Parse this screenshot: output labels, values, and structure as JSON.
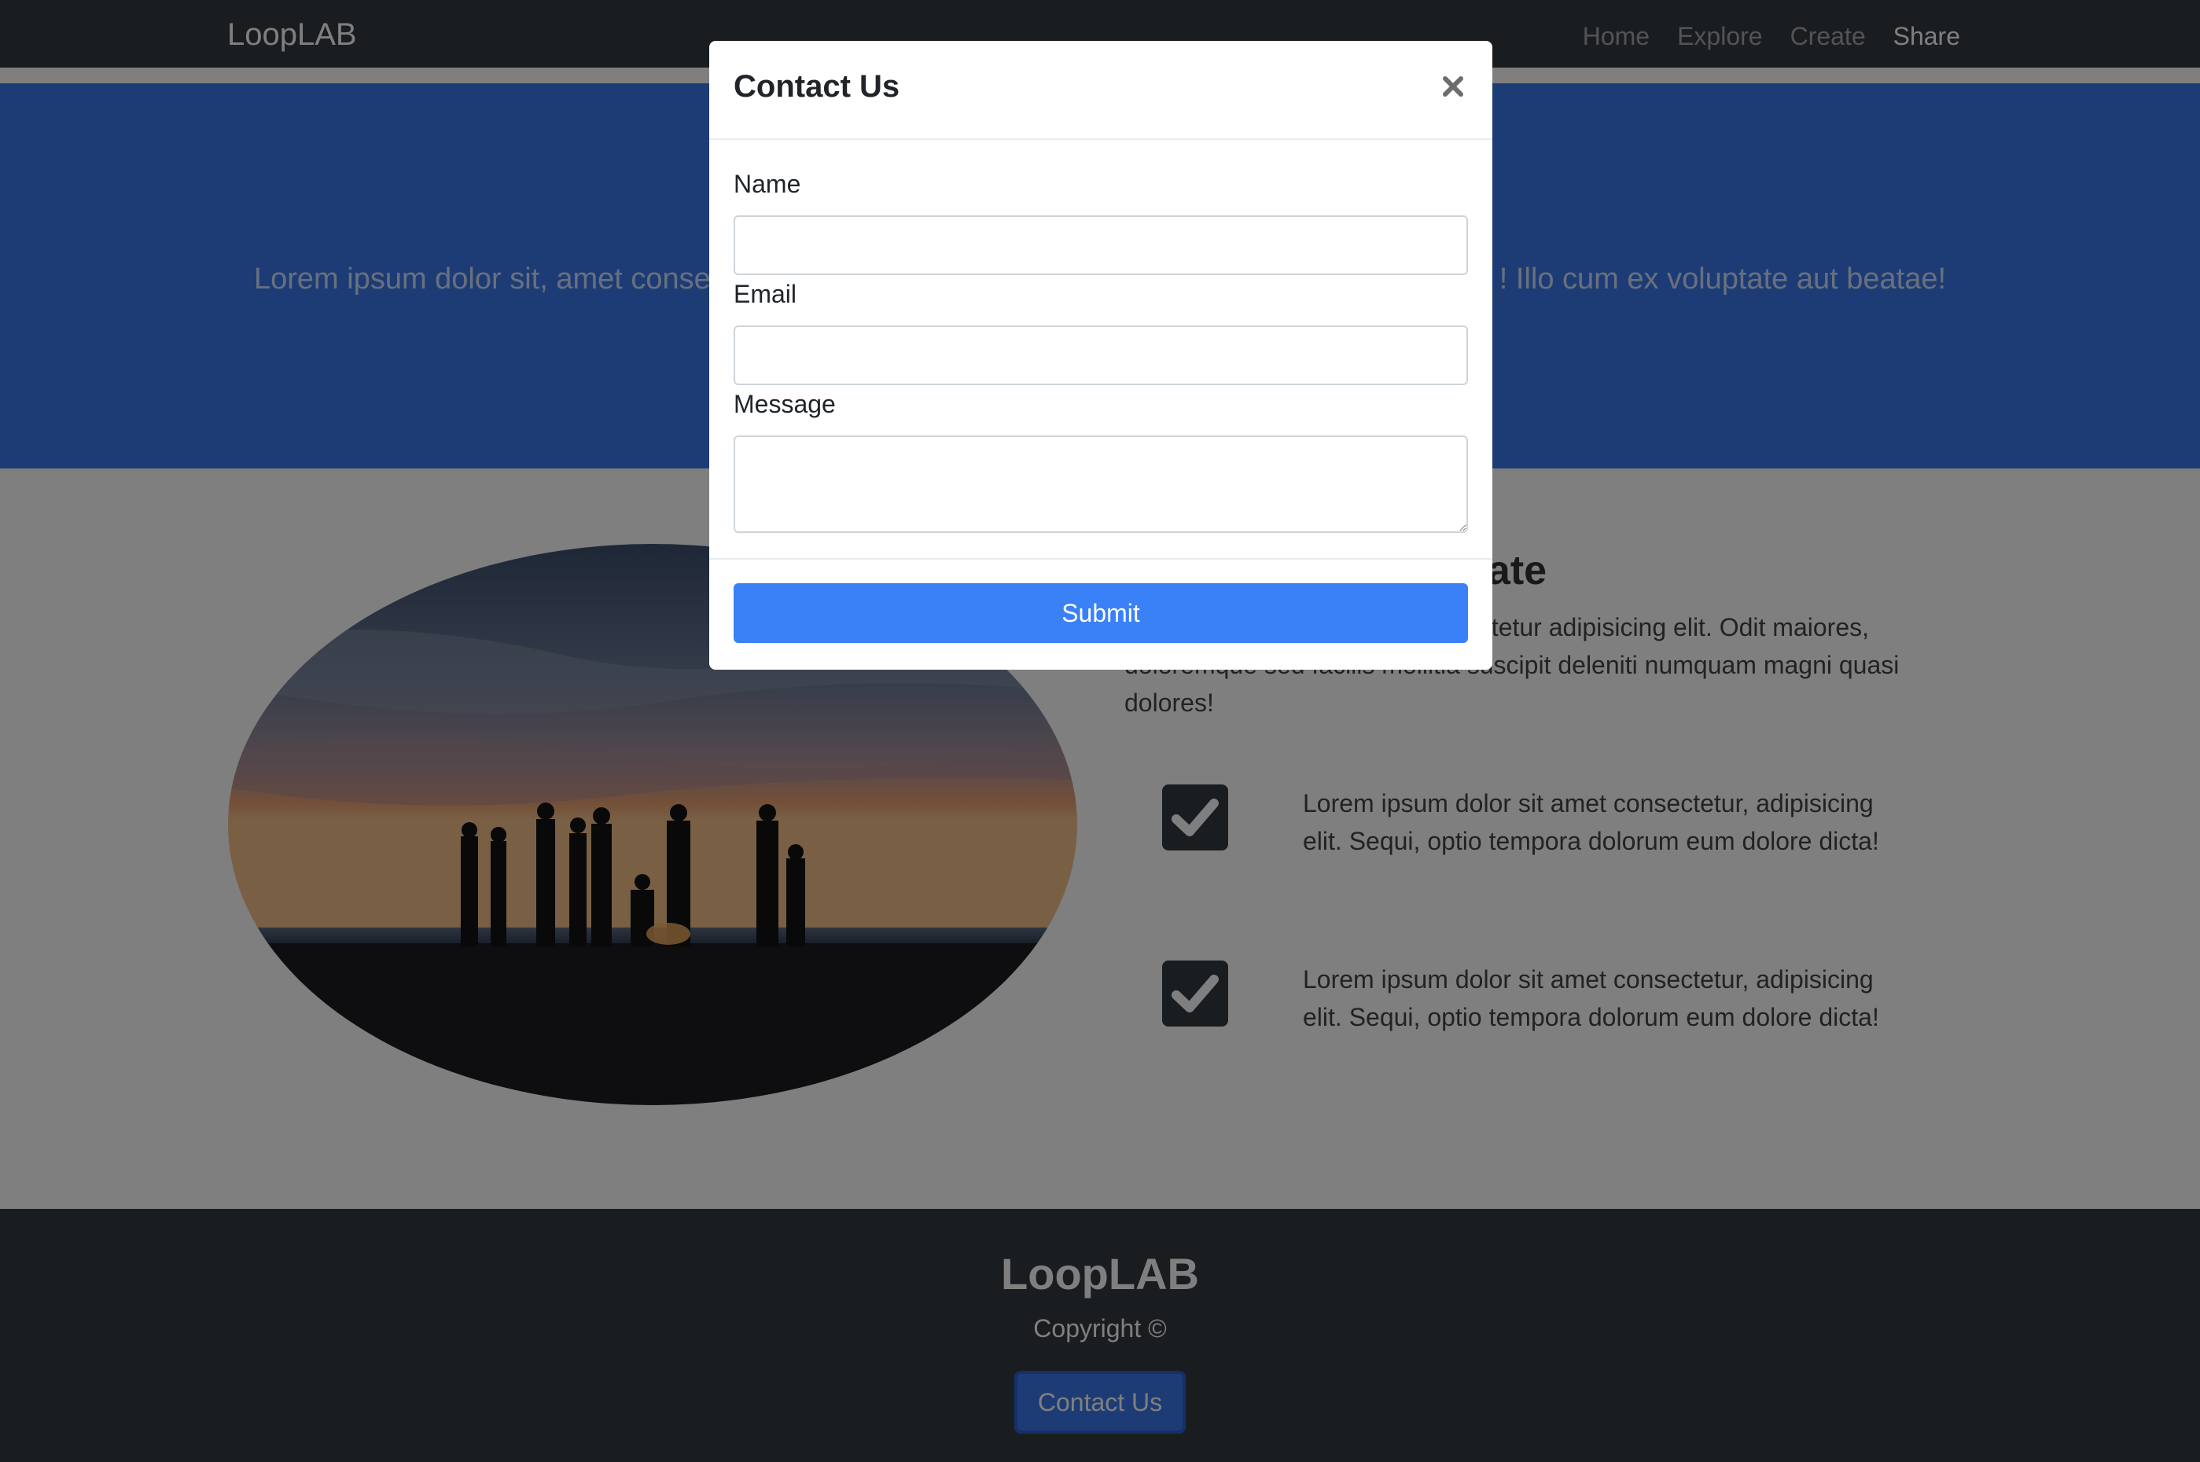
{
  "navbar": {
    "brand": "LoopLAB",
    "links": [
      {
        "label": "Home",
        "active": false
      },
      {
        "label": "Explore",
        "active": false
      },
      {
        "label": "Create",
        "active": false
      },
      {
        "label": "Share",
        "active": true
      }
    ]
  },
  "hero": {
    "text_left": "Lorem ipsum dolor sit, amet conse",
    "text_right": "! Illo cum ex voluptate aut beatae!"
  },
  "features": {
    "title_visible": "eate",
    "text_line1_visible": "ectetur adipisicing elit. Odit maiores,",
    "text_line2_visible": "doloremque sed facilis mollitia suscipit deleniti numquam magni quasi",
    "text_line3": "dolores!",
    "photo_icon": "photo-campfire-beach",
    "check_icon": "check-square-icon",
    "items": [
      {
        "text": "Lorem ipsum dolor sit amet consectetur, adipisicing elit. Sequi, optio tempora dolorum eum dolore dicta!"
      },
      {
        "text": "Lorem ipsum dolor sit amet consectetur, adipisicing elit. Sequi, optio tempora dolorum eum dolore dicta!"
      }
    ]
  },
  "footer": {
    "brand": "LoopLAB",
    "copyright": "Copyright ©",
    "contact_button": "Contact Us"
  },
  "modal": {
    "title": "Contact Us",
    "close_symbol": "×",
    "fields": {
      "name": {
        "label": "Name",
        "value": ""
      },
      "email": {
        "label": "Email",
        "value": ""
      },
      "message": {
        "label": "Message",
        "value": ""
      }
    },
    "submit_label": "Submit"
  },
  "colors": {
    "navbar": "#343a40",
    "hero": "#3a79ec",
    "primary_button": "#3a80f6",
    "backdrop": "rgba(0,0,0,0.5)"
  }
}
